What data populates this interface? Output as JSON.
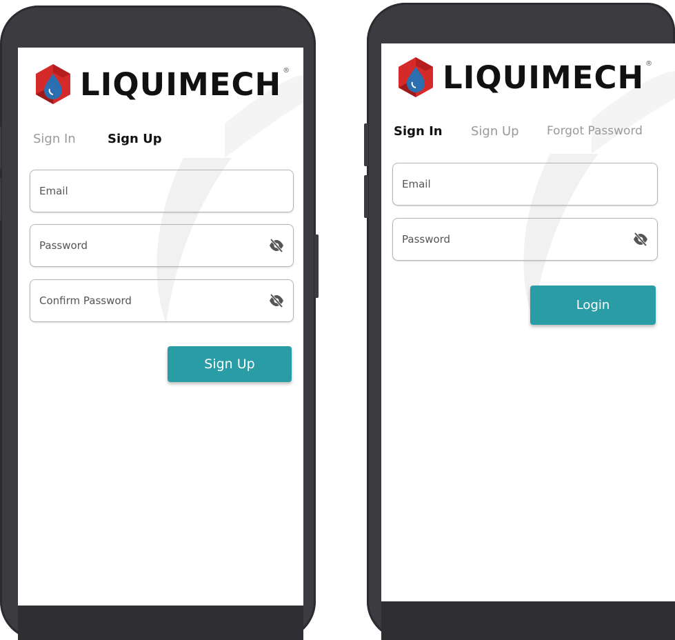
{
  "brand": {
    "name": "LIQUIMECH",
    "registered_mark": "®"
  },
  "colors": {
    "accent": "#2a9ca6",
    "frame": "#3c3c40",
    "logo_red": "#d42a2a",
    "logo_blue": "#2c6fb0"
  },
  "signup_screen": {
    "tabs": [
      {
        "label": "Sign In"
      },
      {
        "label": "Sign Up"
      }
    ],
    "active_tab": "Sign Up",
    "email_placeholder": "Email",
    "password_placeholder": "Password",
    "confirm_password_placeholder": "Confirm Password",
    "submit_label": "Sign Up",
    "icons": {
      "password_toggle": "eye-off-icon"
    }
  },
  "signin_screen": {
    "tabs": [
      {
        "label": "Sign In"
      },
      {
        "label": "Sign Up"
      },
      {
        "label": "Forgot Password"
      }
    ],
    "active_tab": "Sign In",
    "email_placeholder": "Email",
    "password_placeholder": "Password",
    "submit_label": "Login",
    "icons": {
      "password_toggle": "eye-off-icon"
    }
  }
}
